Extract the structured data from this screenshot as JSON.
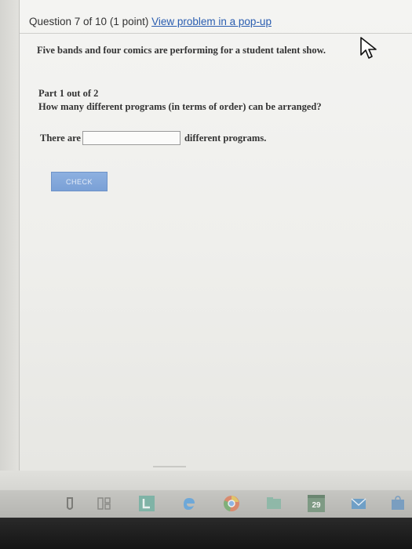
{
  "question": {
    "header": "Question 7 of 10 (1 point)",
    "popup_link": "View problem in a pop-up",
    "problem_text": "Five bands and four comics are performing for a student talent show."
  },
  "part": {
    "label": "Part 1 out of 2",
    "question": "How many different programs (in terms of order) can be arranged?"
  },
  "answer": {
    "prefix": "There are",
    "value": "",
    "suffix": "different programs."
  },
  "check_button": {
    "label": "CHECK"
  },
  "taskbar": {
    "icons": [
      "file-explorer-icon",
      "task-view-icon",
      "learn-app-icon",
      "edge-browser-icon",
      "chrome-browser-icon",
      "folder-icon",
      "calendar-icon",
      "mail-icon",
      "store-icon"
    ],
    "calendar_text": "29"
  },
  "colors": {
    "link": "#2a5db0",
    "button": "#7aa0d6",
    "text": "#333333"
  }
}
